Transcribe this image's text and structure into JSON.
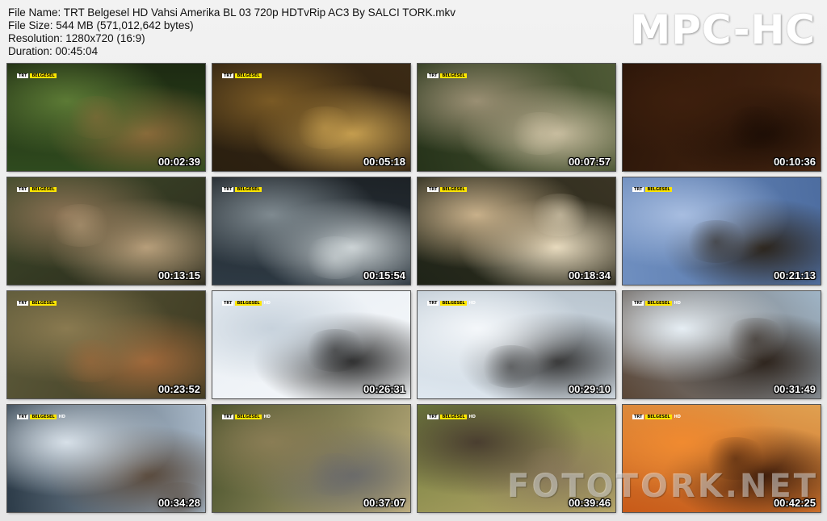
{
  "info": {
    "file_name": "File Name: TRT Belgesel HD Vahsi Amerika BL 03 720p HDTvRip AC3 By SALCI TORK.mkv",
    "file_size": "File Size: 544 MB (571,012,642 bytes)",
    "resolution": "Resolution: 1280x720 (16:9)",
    "duration": "Duration: 00:45:04"
  },
  "logo": "MPC-HC",
  "watermark": "FOTOTORK.NET",
  "badge": {
    "trt": "TRT",
    "belgesel": "BELGESEL",
    "hd": "HD"
  },
  "thumbnails": [
    {
      "time": "00:02:39",
      "scene": "jaguar-in-foliage",
      "colors": [
        "#2f4a1e",
        "#5c7a35",
        "#8a6a3a",
        "#1d2a12"
      ]
    },
    {
      "time": "00:05:18",
      "scene": "jaguar-in-water",
      "colors": [
        "#2a1f10",
        "#7a5a25",
        "#c8a050",
        "#3b2a15"
      ]
    },
    {
      "time": "00:07:57",
      "scene": "deer-on-riverbed",
      "colors": [
        "#26331a",
        "#9a8f73",
        "#c9bea0",
        "#4f5a36"
      ]
    },
    {
      "time": "00:10:36",
      "scene": "dark-brown-frame",
      "colors": [
        "#2a1509",
        "#3d1f0d",
        "#1e0e05",
        "#4a2812"
      ]
    },
    {
      "time": "00:13:15",
      "scene": "bear-closeup",
      "colors": [
        "#3e4a2a",
        "#8c7355",
        "#b9a07c",
        "#2b2a1c"
      ]
    },
    {
      "time": "00:15:54",
      "scene": "rocky-stream",
      "colors": [
        "#2e3a44",
        "#7f8a90",
        "#cfd6d8",
        "#1d2226"
      ]
    },
    {
      "time": "00:18:34",
      "scene": "spirit-bear",
      "colors": [
        "#1f2418",
        "#c8b08a",
        "#e9dcc0",
        "#3a3424"
      ]
    },
    {
      "time": "00:21:13",
      "scene": "branches-sky",
      "colors": [
        "#6f8fc0",
        "#a7bde0",
        "#2a2218",
        "#4d6da0"
      ]
    },
    {
      "time": "00:23:52",
      "scene": "elk-fighting",
      "colors": [
        "#5d5a3a",
        "#8a7a50",
        "#a0683a",
        "#3d3a22"
      ]
    },
    {
      "time": "00:26:31",
      "scene": "elk-in-snow",
      "colors": [
        "#e8eef4",
        "#c7d2dc",
        "#2b2b2b",
        "#f6f8fa"
      ]
    },
    {
      "time": "00:29:10",
      "scene": "wolves-in-snow",
      "colors": [
        "#dfe8f0",
        "#f4f7fa",
        "#333333",
        "#b8c4ce"
      ]
    },
    {
      "time": "00:31:49",
      "scene": "snow-spray-forest",
      "colors": [
        "#5a4636",
        "#e6eef4",
        "#2a2018",
        "#9fb4c6"
      ]
    },
    {
      "time": "00:34:28",
      "scene": "frozen-river",
      "colors": [
        "#2c3b48",
        "#d7e0e8",
        "#58483a",
        "#a8b8c8"
      ]
    },
    {
      "time": "00:37:07",
      "scene": "grass-animal",
      "colors": [
        "#3f4a24",
        "#8a7d55",
        "#6a6a6a",
        "#c0b080"
      ]
    },
    {
      "time": "00:39:46",
      "scene": "dust-cloud",
      "colors": [
        "#6b7a3a",
        "#4a3e30",
        "#8a7a5a",
        "#b8a86a"
      ]
    },
    {
      "time": "00:42:25",
      "scene": "forest-fire",
      "colors": [
        "#c85a18",
        "#f08a30",
        "#3a1a0a",
        "#e0a050"
      ]
    }
  ]
}
